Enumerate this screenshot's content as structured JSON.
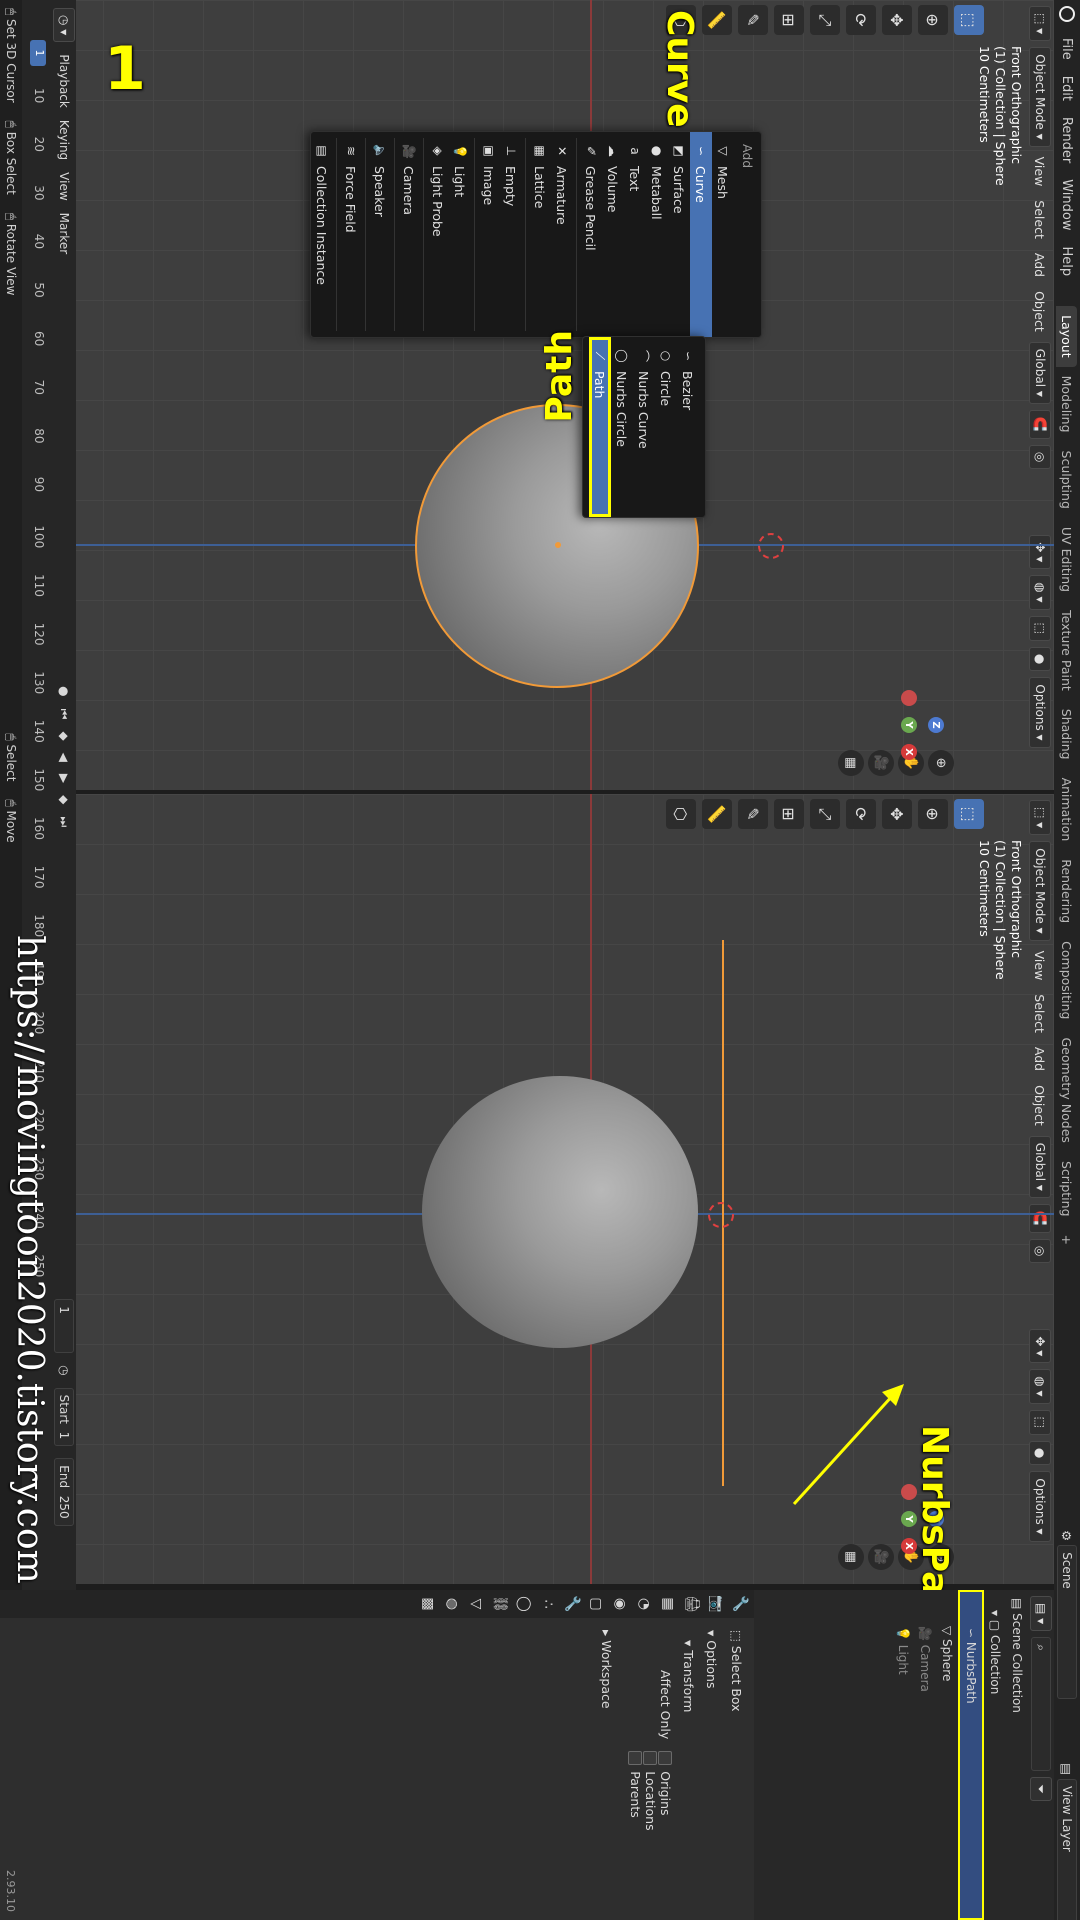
{
  "topbar": {
    "menus": [
      "File",
      "Edit",
      "Render",
      "Window",
      "Help"
    ],
    "workspaces": [
      "Layout",
      "Modeling",
      "Sculpting",
      "UV Editing",
      "Texture Paint",
      "Shading",
      "Animation",
      "Rendering",
      "Compositing",
      "Geometry Nodes",
      "Scripting"
    ],
    "active_workspace": "Layout",
    "add_workspace": "+",
    "scene": "Scene",
    "view_layer": "View Layer"
  },
  "viewport_header": {
    "mode": "Object Mode",
    "menus": [
      "View",
      "Select",
      "Add",
      "Object"
    ],
    "orientation": "Global",
    "options": "Options"
  },
  "overlay_text": {
    "line1": "Front Orthographic",
    "line2": "(1) Collection | Sphere",
    "line3": "10 Centimeters"
  },
  "add_menu": {
    "title": "Add",
    "items": [
      "Mesh",
      "Curve",
      "Surface",
      "Metaball",
      "Text",
      "Volume",
      "Grease Pencil",
      "Armature",
      "Lattice",
      "Empty",
      "Image",
      "Light",
      "Light Probe",
      "Camera",
      "Speaker",
      "Force Field",
      "Collection Instance"
    ],
    "highlighted": "Curve"
  },
  "curve_submenu": {
    "items": [
      "Bezier",
      "Circle",
      "Nurbs Curve",
      "Nurbs Circle",
      "Path"
    ],
    "highlighted": "Path"
  },
  "callouts": {
    "step": "1",
    "curve": "Curve",
    "path": "Path",
    "nurbspath": "NurbsPath"
  },
  "timeline": {
    "menus": [
      "Playback",
      "Keying",
      "View",
      "Marker"
    ],
    "current_frame": "1",
    "ticks": [
      "10",
      "20",
      "30",
      "40",
      "50",
      "60",
      "70",
      "80",
      "90",
      "100",
      "110",
      "120",
      "130",
      "140",
      "150",
      "160",
      "170",
      "180",
      "190",
      "200",
      "210",
      "220",
      "230",
      "240",
      "250"
    ],
    "frame_field": "1",
    "start_label": "Start",
    "start_value": "1",
    "end_label": "End",
    "end_value": "250"
  },
  "outliner": {
    "root": "Scene Collection",
    "collection": "Collection",
    "items": [
      "NurbsPath",
      "Sphere",
      "Camera",
      "Light"
    ],
    "selected": "NurbsPath"
  },
  "properties": {
    "tool_name": "Select Box",
    "sections": {
      "options": "Options",
      "transform": "Transform",
      "affect_only": "Affect Only",
      "origins": "Origins",
      "locations": "Locations",
      "parents": "Parents",
      "workspace": "Workspace"
    }
  },
  "statusbar": {
    "items": [
      "Set 3D Cursor",
      "Box Select",
      "Rotate View",
      "Select",
      "Move"
    ],
    "version": "2.93.10"
  },
  "watermark": "https://movingtoon2020.tistory.com",
  "colors": {
    "accent": "#4772b3",
    "selection_orange": "#f19a38",
    "callout_yellow": "#ffff00"
  }
}
